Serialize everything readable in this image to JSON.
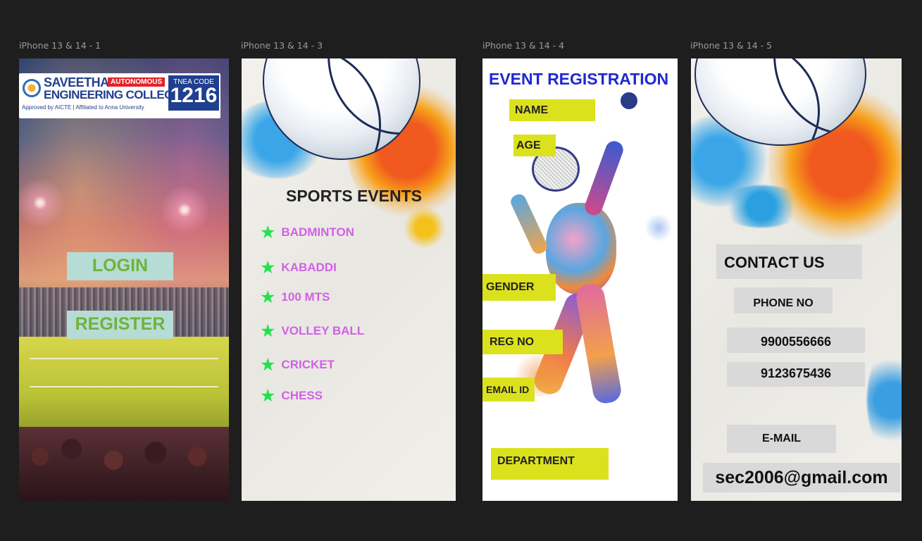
{
  "frames": [
    {
      "label": "iPhone 13 & 14 - 1"
    },
    {
      "label": "iPhone 13 & 14 - 3"
    },
    {
      "label": "iPhone 13 & 14 - 4"
    },
    {
      "label": "iPhone 13 & 14 - 5"
    }
  ],
  "home": {
    "logo": {
      "line1": "SAVEETHA",
      "badge": "AUTONOMOUS",
      "line2": "ENGINEERING COLLEGE",
      "sub": "Approved by AICTE | Affiliated to Anna University",
      "tnea_label": "TNEA CODE",
      "tnea_code": "1216"
    },
    "login_label": "LOGIN",
    "register_label": "REGISTER"
  },
  "sports": {
    "title": "SPORTS EVENTS",
    "events": [
      "BADMINTON",
      "KABADDI",
      "100 MTS",
      "VOLLEY BALL",
      "CRICKET",
      "CHESS"
    ],
    "star_glyph": "★"
  },
  "registration": {
    "title": "EVENT REGISTRATION",
    "fields": {
      "name": "NAME",
      "age": "AGE",
      "gender": "GENDER",
      "reg_no": "REG NO",
      "email_id": "EMAIL ID",
      "department": "DEPARTMENT"
    }
  },
  "contact": {
    "title": "CONTACT US",
    "phone_label": "PHONE NO",
    "phones": [
      "9900556666",
      "9123675436"
    ],
    "email_label": "E-MAIL",
    "email": "sec2006@gmail.com"
  },
  "colors": {
    "canvas": "#1e1e1e",
    "event_text": "#d061e6",
    "star": "#22e24c",
    "reg_title": "#2027d3",
    "field_bg": "#dbe21d",
    "login_bg": "#b7dcd6",
    "login_text": "#6fb33a",
    "contact_box": "#d9d9d9"
  }
}
